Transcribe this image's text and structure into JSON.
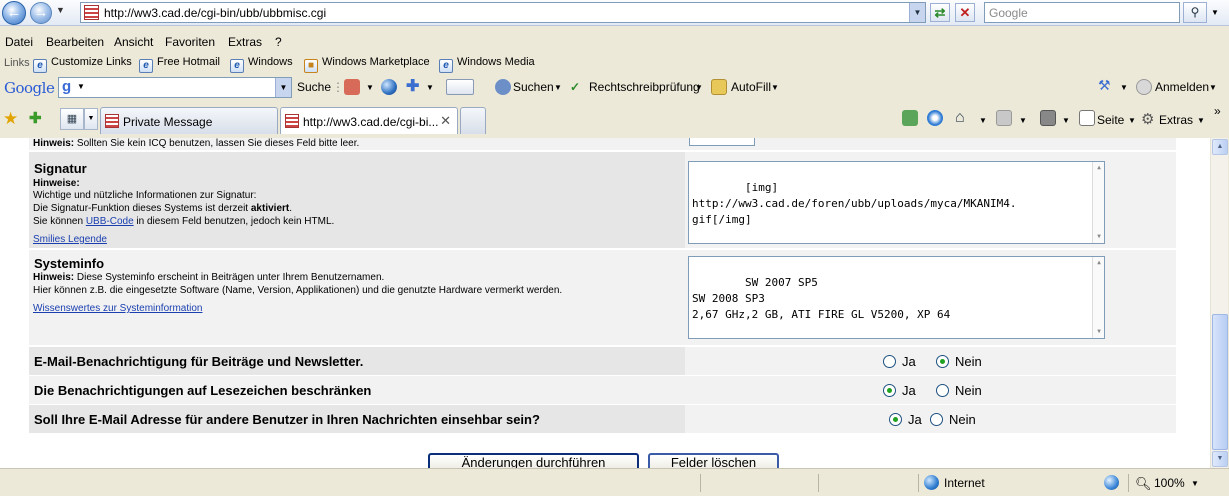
{
  "address_bar": {
    "url": "http://ww3.cad.de/cgi-bin/ubb/ubbmisc.cgi",
    "search_placeholder": "Google"
  },
  "menu": [
    "Datei",
    "Bearbeiten",
    "Ansicht",
    "Favoriten",
    "Extras",
    "?"
  ],
  "links_bar": {
    "label": "Links",
    "items": [
      "Customize Links",
      "Free Hotmail",
      "Windows",
      "Windows Marketplace",
      "Windows Media"
    ]
  },
  "google_bar": {
    "logo": "Google",
    "search_label": "Suche",
    "suchen_label": "Suchen",
    "spell_label": "Rechtschreibprüfung",
    "autofill_label": "AutoFill",
    "signin_label": "Anmelden"
  },
  "tabs": [
    {
      "label": "Private Message",
      "active": false
    },
    {
      "label": "http://ww3.cad.de/cgi-bi...",
      "active": true
    }
  ],
  "command_bar": {
    "page_label": "Seite",
    "extras_label": "Extras"
  },
  "form": {
    "top_hint_bold": "Hinweis:",
    "top_hint": "Sollten Sie kein ICQ benutzen, lassen Sie dieses Feld bitte leer.",
    "signatur": {
      "title": "Signatur",
      "hint_heading": "Hinweise:",
      "line1": "Wichtige und nützliche Informationen zur Signatur:",
      "line2_pre": "Die Signatur-Funktion dieses Systems ist derzeit ",
      "line2_bold": "aktiviert",
      "line2_post": ".",
      "line3_pre": "Sie können ",
      "line3_link": "UBB-Code",
      "line3_post": " in diesem Feld benutzen, jedoch kein HTML.",
      "smilies_link": "Smilies Legende",
      "value": "[img]\nhttp://ww3.cad.de/foren/ubb/uploads/myca/MKANIM4.\ngif[/img]"
    },
    "systeminfo": {
      "title": "Systeminfo",
      "hint_bold": "Hinweis:",
      "line1": "Diese Systeminfo erscheint in Beiträgen unter Ihrem Benutzernamen.",
      "line2": "Hier können z.B. die eingesetzte Software (Name, Version, Applikationen) und die genutzte Hardware vermerkt werden.",
      "link": "Wissenswertes zur Systeminformation",
      "value": "SW 2007 SP5\nSW 2008 SP3\n2,67 GHz,2 GB, ATI FIRE GL V5200, XP 64"
    },
    "questions": [
      {
        "label": "E-Mail-Benachrichtigung für Beiträge und Newsletter.",
        "yes": "Ja",
        "no": "Nein",
        "selected": "no"
      },
      {
        "label": "Die Benachrichtigungen auf Lesezeichen beschränken",
        "yes": "Ja",
        "no": "Nein",
        "selected": "yes"
      },
      {
        "label": "Soll Ihre E-Mail Adresse für andere Benutzer in Ihren Nachrichten einsehbar sein?",
        "yes": "Ja",
        "no": "Nein",
        "selected": "yes"
      }
    ],
    "submit_label": "Änderungen durchführen",
    "reset_label": "Felder löschen"
  },
  "status_bar": {
    "zone": "Internet",
    "zoom": "100%"
  }
}
